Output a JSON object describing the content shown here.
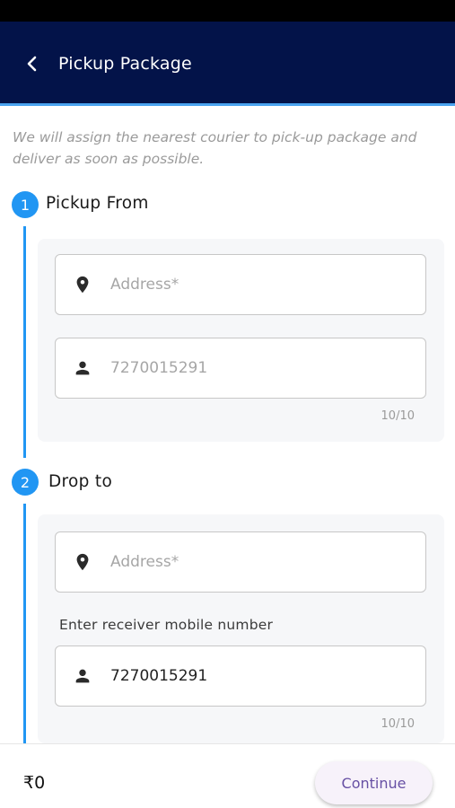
{
  "appbar": {
    "title": "Pickup Package"
  },
  "intro": "We will assign the nearest courier to pick-up package and deliver as soon as possible.",
  "pickup": {
    "step_number": "1",
    "title": "Pickup From",
    "address_placeholder": "Address*",
    "phone_placeholder": "7270015291",
    "counter": "10/10"
  },
  "drop": {
    "step_number": "2",
    "title": "Drop to",
    "address_placeholder": "Address*",
    "receiver_label": "Enter receiver mobile number",
    "phone_value": "7270015291",
    "counter": "10/10"
  },
  "footer": {
    "price": "₹0",
    "continue_label": "Continue"
  },
  "colors": {
    "appbar_bg": "#031349",
    "accent": "#2196f3",
    "button_text": "#6750a4"
  },
  "icons": {
    "back": "chevron-left-icon",
    "address": "location-pin-icon",
    "phone": "person-icon"
  }
}
